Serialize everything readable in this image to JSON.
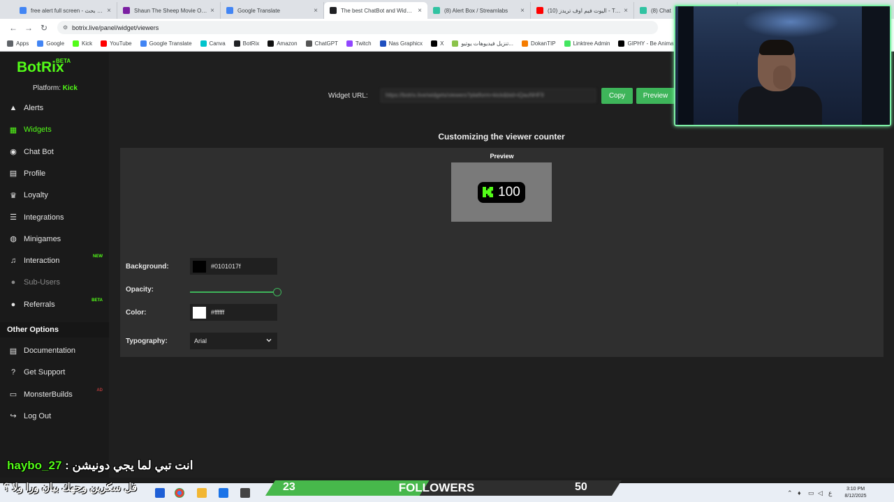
{
  "browser": {
    "tabs": [
      {
        "title": "free alert full screen - بحث Goo",
        "color": "#4285f4",
        "active": false
      },
      {
        "title": "Shaun The Sheep Movie Ok Gif",
        "color": "#7b1fa2",
        "active": false
      },
      {
        "title": "Google Translate",
        "color": "#4285f4",
        "active": false
      },
      {
        "title": "The best ChatBot and Widgets",
        "color": "#202124",
        "active": true
      },
      {
        "title": "(8) Alert Box / Streamlabs",
        "color": "#31c3a2",
        "active": false
      },
      {
        "title": "(10) اليوت فيم اوف تريدز - Tube",
        "color": "#ff0000",
        "active": false
      },
      {
        "title": "(8) Chat",
        "color": "#31c3a2",
        "active": false
      }
    ],
    "url": "botrix.live/panel/widget/viewers",
    "bookmarks": [
      {
        "label": "Apps",
        "color": "#5f6368"
      },
      {
        "label": "Google",
        "color": "#4285f4"
      },
      {
        "label": "Kick",
        "color": "#53fc18"
      },
      {
        "label": "YouTube",
        "color": "#ff0000"
      },
      {
        "label": "Google Translate",
        "color": "#4285f4"
      },
      {
        "label": "Canva",
        "color": "#00c4cc"
      },
      {
        "label": "BotRix",
        "color": "#202124"
      },
      {
        "label": "Amazon",
        "color": "#111111"
      },
      {
        "label": "ChatGPT",
        "color": "#555555"
      },
      {
        "label": "Twitch",
        "color": "#9146ff"
      },
      {
        "label": "Nas Graphicx",
        "color": "#1e4fbf"
      },
      {
        "label": "X",
        "color": "#000000"
      },
      {
        "label": "تنزيل فيديوهات يوتيو...",
        "color": "#8bc34a"
      },
      {
        "label": "DokanTIP",
        "color": "#f57c00"
      },
      {
        "label": "Linktree Admin",
        "color": "#43e660"
      },
      {
        "label": "GIPHY - Be Animated",
        "color": "#000000"
      }
    ]
  },
  "sidebar": {
    "logo": "BotRix",
    "logo_badge": "BETA",
    "platform_label": "Platform:",
    "platform_value": "Kick",
    "items": [
      {
        "label": "Alerts",
        "icon": "warning-icon",
        "glyph": "▲",
        "state": "normal",
        "badge": ""
      },
      {
        "label": "Widgets",
        "icon": "grid-icon",
        "glyph": "▦",
        "state": "active",
        "badge": ""
      },
      {
        "label": "Chat Bot",
        "icon": "robot-icon",
        "glyph": "◉",
        "state": "normal",
        "badge": ""
      },
      {
        "label": "Profile",
        "icon": "id-card-icon",
        "glyph": "▤",
        "state": "normal",
        "badge": ""
      },
      {
        "label": "Loyalty",
        "icon": "trophy-icon",
        "glyph": "♛",
        "state": "normal",
        "badge": ""
      },
      {
        "label": "Integrations",
        "icon": "list-icon",
        "glyph": "☰",
        "state": "normal",
        "badge": ""
      },
      {
        "label": "Minigames",
        "icon": "gamepad-icon",
        "glyph": "◍",
        "state": "normal",
        "badge": ""
      },
      {
        "label": "Interaction",
        "icon": "music-icon",
        "glyph": "♫",
        "state": "normal",
        "badge": "NEW",
        "badge_color": "#53fc18"
      },
      {
        "label": "Sub-Users",
        "icon": "users-icon",
        "glyph": "●",
        "state": "disabled",
        "badge": ""
      },
      {
        "label": "Referrals",
        "icon": "user-group-icon",
        "glyph": "●",
        "state": "normal",
        "badge": "BETA",
        "badge_color": "#53fc18"
      }
    ],
    "other_title": "Other Options",
    "other_items": [
      {
        "label": "Documentation",
        "icon": "book-icon",
        "glyph": "▤",
        "badge": ""
      },
      {
        "label": "Get Support",
        "icon": "question-icon",
        "glyph": "?",
        "badge": ""
      },
      {
        "label": "MonsterBuilds",
        "icon": "monitor-icon",
        "glyph": "▭",
        "badge": "AD",
        "badge_color": "#b33a3a"
      },
      {
        "label": "Log Out",
        "icon": "logout-icon",
        "glyph": "↪",
        "badge": ""
      }
    ]
  },
  "main": {
    "widget_url_label": "Widget URL:",
    "widget_url_value": "https://botrix.live/widgets/viewers?platform=kick&bid=iQauNHF9",
    "copy_label": "Copy",
    "preview_label": "Preview",
    "heading": "Customizing the viewer counter",
    "preview_title": "Preview",
    "viewer_count": "100",
    "fields": {
      "background_label": "Background:",
      "background_value": "#0101017f",
      "background_swatch": "#010101",
      "opacity_label": "Opacity:",
      "opacity_value": 1.0,
      "color_label": "Color:",
      "color_value": "#ffffff",
      "color_swatch": "#ffffff",
      "typography_label": "Typography:",
      "typography_value": "Arial"
    }
  },
  "overlay": {
    "chat_user": "haybo_27",
    "chat_text": "انت تبي لما يجي دونيشن :",
    "chat_line2": "فل سكرين وجهك بيان ورا ولا ؟",
    "followers_label": "FOLLOWERS",
    "followers_current": "23",
    "followers_goal": "50",
    "followers_progress": 0.46
  },
  "taskbar": {
    "time": "3:10 PM",
    "date": "8/12/2025",
    "lang": "ع"
  },
  "colors": {
    "accent": "#53fc18",
    "button": "#3eb55a"
  }
}
